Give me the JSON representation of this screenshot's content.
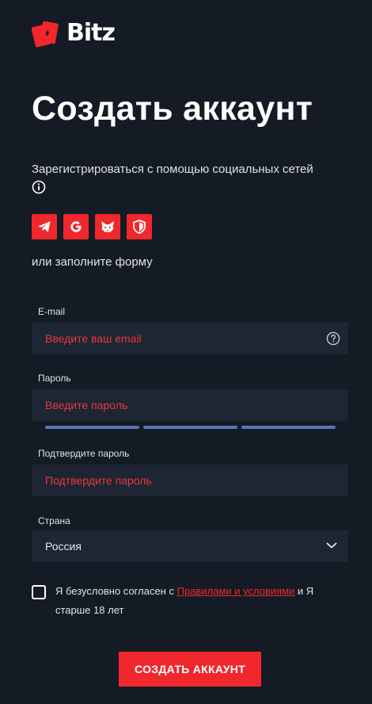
{
  "brand": {
    "logo_text": "Bitz",
    "accent": "#f0282d"
  },
  "page": {
    "title": "Создать аккаунт"
  },
  "social": {
    "label": "Зарегистрироваться с помощью социальных сетей",
    "info_icon": "info-icon",
    "buttons": [
      {
        "icon": "telegram-icon"
      },
      {
        "icon": "google-icon"
      },
      {
        "icon": "metamask-icon"
      },
      {
        "icon": "shield-icon"
      }
    ]
  },
  "form": {
    "alt_label": "или заполните форму",
    "email": {
      "label": "E-mail",
      "placeholder": "Введите ваш email",
      "help_icon": "question-icon"
    },
    "password": {
      "label": "Пароль",
      "placeholder": "Введите пароль"
    },
    "confirm": {
      "label": "Подтвердите пароль",
      "placeholder": "Подтвердите пароль"
    },
    "country": {
      "label": "Страна",
      "value": "Россия"
    },
    "terms": {
      "prefix": "Я безусловно согласен с ",
      "link": "Правилами и условиями",
      "suffix": " и Я старше 18 лет",
      "checked": false
    },
    "submit_label": "СОЗДАТЬ АККАУНТ"
  }
}
